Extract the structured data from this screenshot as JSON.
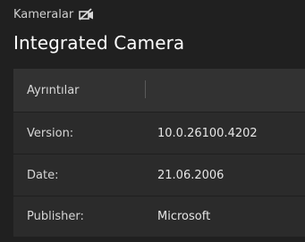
{
  "breadcrumb": {
    "parent_label": "Kameralar",
    "icon": "camera-off-icon"
  },
  "title": "Integrated Camera",
  "details": {
    "header": "Ayrıntılar",
    "rows": [
      {
        "key": "Version:",
        "value": "10.0.26100.4202"
      },
      {
        "key": "Date:",
        "value": "21.06.2006"
      },
      {
        "key": "Publisher:",
        "value": "Microsoft"
      }
    ]
  },
  "colors": {
    "background": "#202020",
    "panel": "#2b2b2b",
    "header": "#323232",
    "text": "#ffffff"
  }
}
